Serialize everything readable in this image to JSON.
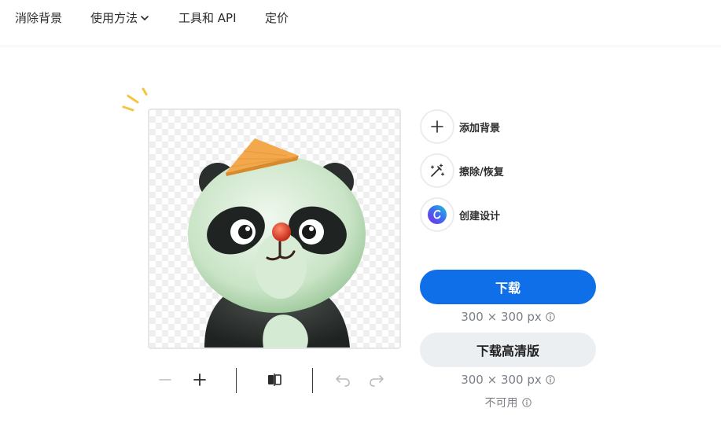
{
  "nav": {
    "items": [
      {
        "label": "消除背景"
      },
      {
        "label": "使用方法"
      },
      {
        "label": "工具和 API"
      },
      {
        "label": "定价"
      }
    ]
  },
  "side_actions": [
    {
      "label": "添加背景",
      "icon": "plus-icon"
    },
    {
      "label": "擦除/恢复",
      "icon": "magic-brush-icon"
    },
    {
      "label": "创建设计",
      "icon": "canva-logo-icon"
    }
  ],
  "download": {
    "label": "下载",
    "size": "300 × 300 px"
  },
  "download_hd": {
    "label": "下载高清版",
    "size": "300 × 300 px",
    "status": "不可用"
  },
  "toolbar": {
    "icons": [
      "zoom-out-icon",
      "zoom-in-icon",
      "compare-icon",
      "undo-icon",
      "redo-icon"
    ]
  },
  "colors": {
    "primary": "#0f6fe8",
    "secondary_bg": "#eceff2",
    "sparkle": "#f5c542"
  }
}
